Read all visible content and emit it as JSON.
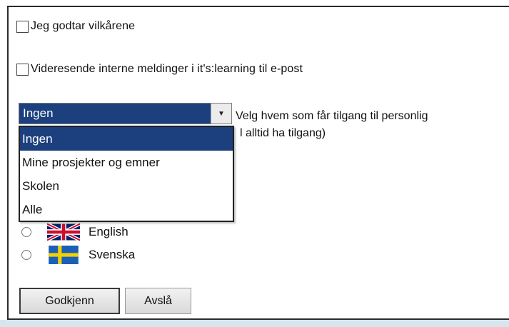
{
  "terms": {
    "accept_label": "Jeg godtar vilkårene",
    "forward_label": "Videresende interne meldinger i it's:learning til e-post"
  },
  "visibility": {
    "selected_value": "Ingen",
    "help_line1": "Velg hvem som får tilgang til personlig",
    "help_line2": "l alltid ha tilgang)",
    "options": [
      "Ingen",
      "Mine prosjekter og emner",
      "Skolen",
      "Alle"
    ]
  },
  "languages": [
    {
      "label": "English",
      "flag": "uk-flag-icon"
    },
    {
      "label": "Svenska",
      "flag": "sweden-flag-icon"
    }
  ],
  "buttons": {
    "approve": "Godkjenn",
    "decline": "Avslå"
  },
  "colors": {
    "selection": "#1c3f7d",
    "footer_strip": "#d7e6ec"
  }
}
